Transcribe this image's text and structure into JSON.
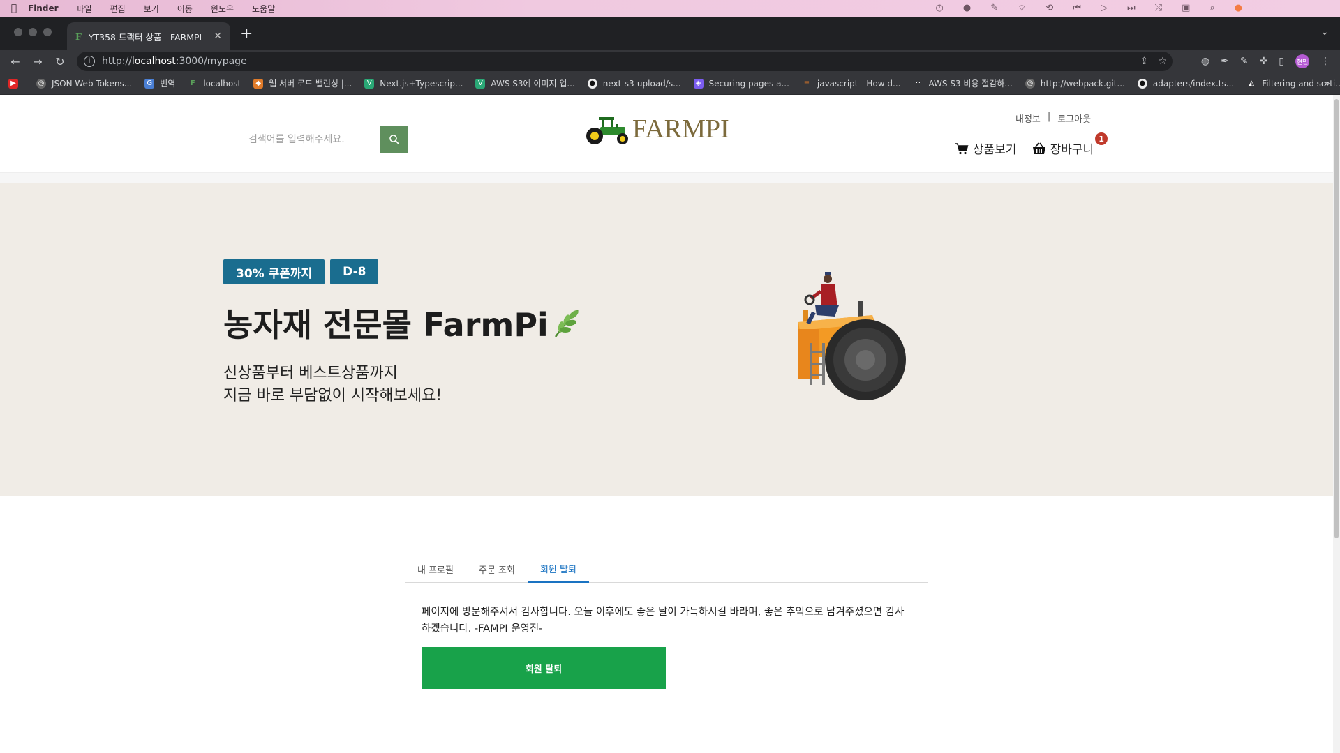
{
  "menubar": {
    "app": "Finder",
    "items": [
      "파일",
      "편집",
      "보기",
      "이동",
      "윈도우",
      "도움말"
    ]
  },
  "browser": {
    "tab_title": "YT358 트랙터 상품 - FARMPI",
    "tab_favicon": "F",
    "url_prefix": "http://",
    "url_host": "localhost",
    "url_path": ":3000/mypage",
    "profile_label": "현민",
    "bookmarks": [
      {
        "label": "",
        "icon": "youtube-icon",
        "color": "#e02626"
      },
      {
        "label": "JSON Web Tokens...",
        "icon": "globe-icon",
        "color": "#888888"
      },
      {
        "label": "번역",
        "icon": "translate-icon",
        "color": "#4a7fd4"
      },
      {
        "label": "localhost",
        "icon": "farmpi-favicon-icon",
        "color": "#5aa05a"
      },
      {
        "label": "웹 서버 로드 밸런싱 |...",
        "icon": "box-icon",
        "color": "#e07b2a"
      },
      {
        "label": "Next.js+Typescrip...",
        "icon": "v-icon",
        "color": "#2aa876"
      },
      {
        "label": "AWS S3에 이미지 업...",
        "icon": "v-icon",
        "color": "#2aa876"
      },
      {
        "label": "next-s3-upload/s...",
        "icon": "github-icon",
        "color": "#ffffff"
      },
      {
        "label": "Securing pages a...",
        "icon": "shield-icon",
        "color": "#7b5cf0"
      },
      {
        "label": "javascript - How d...",
        "icon": "stackoverflow-icon",
        "color": "#f48024"
      },
      {
        "label": "AWS S3 비용 절감하...",
        "icon": "dots-icon",
        "color": "#d5d7da"
      },
      {
        "label": "http://webpack.git...",
        "icon": "globe-icon",
        "color": "#888888"
      },
      {
        "label": "adapters/index.ts...",
        "icon": "github-icon",
        "color": "#ffffff"
      },
      {
        "label": "Filtering and sorti...",
        "icon": "drop-icon",
        "color": "#d5d7da"
      }
    ]
  },
  "header": {
    "search_placeholder": "검색어를 입력해주세요.",
    "logo_text": "FARMPI",
    "my_info": "내정보",
    "separator": "|",
    "logout": "로그아웃",
    "products": "상품보기",
    "cart": "장바구니",
    "cart_count": "1"
  },
  "hero": {
    "badge_coupon": "30% 쿠폰까지",
    "badge_dday": "D-8",
    "title": "농자재 전문몰 FarmPi",
    "subtitle_line1": "신상품부터 베스트상품까지",
    "subtitle_line2": "지금 바로 부담없이 시작해보세요!"
  },
  "mypage": {
    "tabs": [
      "내 프로필",
      "주문 조회",
      "회원 탈퇴"
    ],
    "active_tab": "회원 탈퇴",
    "message": "페이지에 방문해주셔서 감사합니다. 오늘 이후에도 좋은 날이 가득하시길 바라며, 좋은 추억으로 남겨주셨으면 감사하겠습니다. -FAMPI 운영진-",
    "withdraw_button": "회원 탈퇴"
  },
  "colors": {
    "accent_green": "#18a24a",
    "badge_blue": "#1a6d8f",
    "hero_bg": "#f0ece6",
    "tab_active": "#1a73c2",
    "search_btn": "#5f8f5d"
  }
}
